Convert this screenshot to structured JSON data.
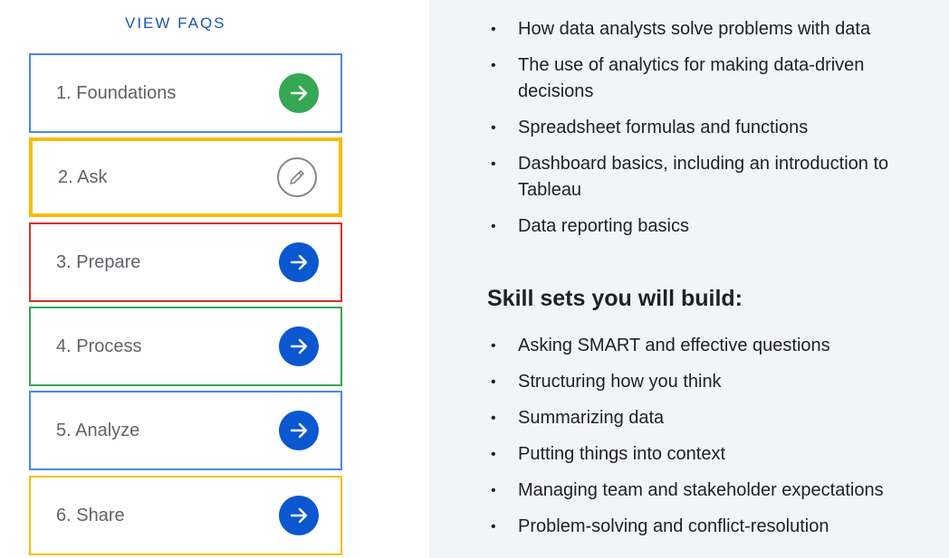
{
  "faq_link": "VIEW FAQS",
  "modules": [
    {
      "label": "1. Foundations",
      "icon": "arrow-right-icon",
      "border": "#4a86e8",
      "btn_bg": "#34a853",
      "btn_fg": "#ffffff"
    },
    {
      "label": "2. Ask",
      "icon": "pencil-icon",
      "border": "#fbbc04",
      "btn_bg": "#ffffff",
      "btn_fg": "#80868b"
    },
    {
      "label": "3. Prepare",
      "icon": "arrow-right-icon",
      "border": "#d93025",
      "btn_bg": "#0b57d0",
      "btn_fg": "#ffffff"
    },
    {
      "label": "4. Process",
      "icon": "arrow-right-icon",
      "border": "#34a853",
      "btn_bg": "#0b57d0",
      "btn_fg": "#ffffff"
    },
    {
      "label": "5. Analyze",
      "icon": "arrow-right-icon",
      "border": "#4a86e8",
      "btn_bg": "#0b57d0",
      "btn_fg": "#ffffff"
    },
    {
      "label": "6. Share",
      "icon": "arrow-right-icon",
      "border": "#fbbc04",
      "btn_bg": "#0b57d0",
      "btn_fg": "#ffffff"
    }
  ],
  "topics": [
    "How data analysts solve problems with data",
    "The use of analytics for making data-driven decisions",
    "Spreadsheet formulas and functions",
    "Dashboard basics, including an introduction to Tableau",
    "Data reporting basics"
  ],
  "skills_heading": "Skill sets you will build:",
  "skills": [
    "Asking SMART and effective questions",
    "Structuring how you think",
    "Summarizing data",
    "Putting things into context",
    "Managing team and stakeholder expectations",
    "Problem-solving and conflict-resolution"
  ]
}
